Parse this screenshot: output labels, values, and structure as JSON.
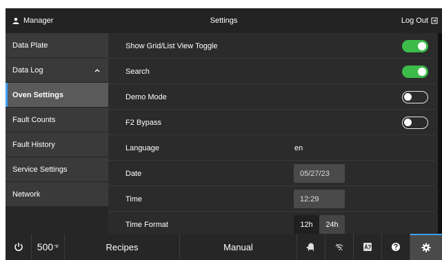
{
  "header": {
    "user": "Manager",
    "title": "Settings",
    "logout_label": "Log Out"
  },
  "sidebar": {
    "items": [
      {
        "label": "Data Plate"
      },
      {
        "label": "Data Log"
      },
      {
        "label": "Oven Settings"
      },
      {
        "label": "Fault Counts"
      },
      {
        "label": "Fault History"
      },
      {
        "label": "Service Settings"
      },
      {
        "label": "Network"
      }
    ],
    "active_index": 2
  },
  "settings": {
    "grid_toggle": {
      "label": "Show Grid/List View Toggle",
      "state": "on"
    },
    "search": {
      "label": "Search",
      "state": "on"
    },
    "demo_mode": {
      "label": "Demo Mode",
      "state": "off"
    },
    "f2_bypass": {
      "label": "F2 Bypass",
      "state": "off"
    },
    "language": {
      "label": "Language",
      "value": "en"
    },
    "date": {
      "label": "Date",
      "value": "05/27/23"
    },
    "time": {
      "label": "Time",
      "value": "12:29"
    },
    "time_format": {
      "label": "Time Format",
      "options": [
        "12h",
        "24h"
      ],
      "selected": "12h"
    }
  },
  "footer": {
    "temperature": "500",
    "temperature_unit": "°F",
    "recipes_label": "Recipes",
    "manual_label": "Manual",
    "icons": [
      "power-icon",
      "oven-mitt-icon",
      "wifi-off-icon",
      "language-icon",
      "help-icon",
      "gear-icon"
    ]
  },
  "colors": {
    "accent": "#3da0f5",
    "toggle_on": "#3dbb4a",
    "background": "#2b2b2b"
  }
}
